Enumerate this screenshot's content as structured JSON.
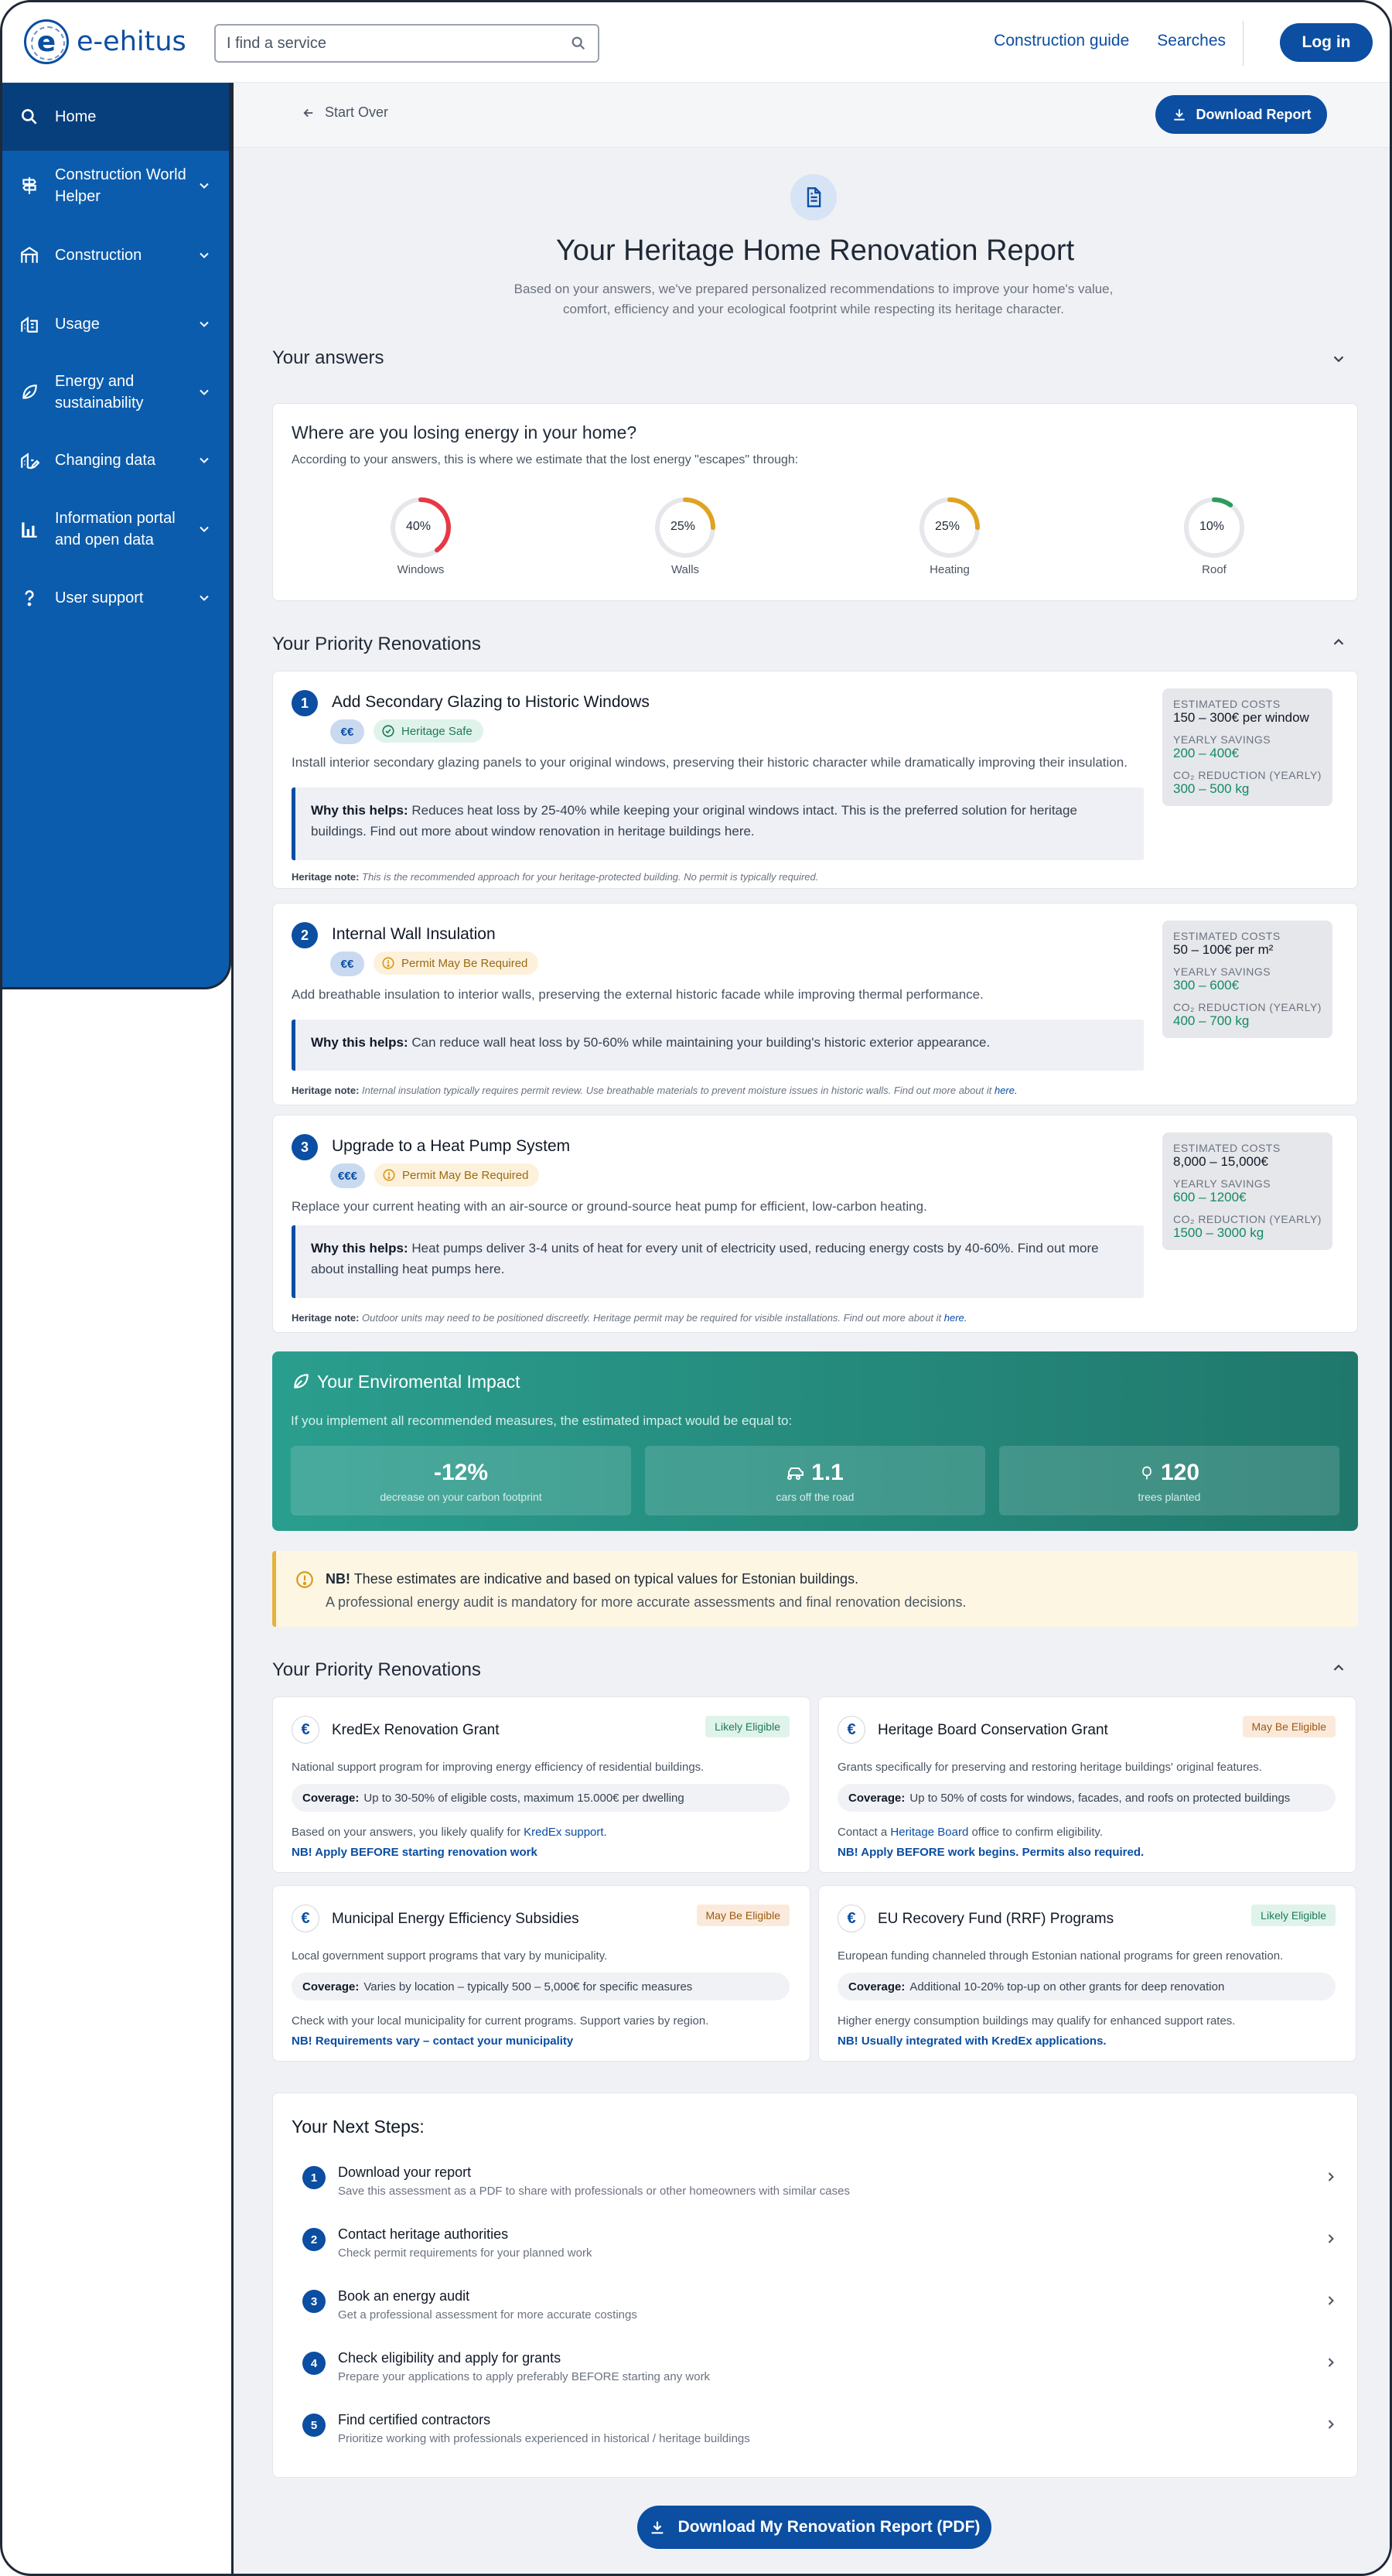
{
  "header": {
    "logo_text": "e-ehitus",
    "search_placeholder": "I find a service",
    "nav": [
      "Construction guide",
      "Searches"
    ],
    "login_label": "Log in"
  },
  "sidebar": {
    "items": [
      {
        "label": "Home",
        "icon": "search-icon",
        "active": true
      },
      {
        "label": "Construction World Helper",
        "icon": "signpost-icon"
      },
      {
        "label": "Construction",
        "icon": "crane-icon"
      },
      {
        "label": "Usage",
        "icon": "building-icon"
      },
      {
        "label": "Energy and sustainability",
        "icon": "leaf-icon"
      },
      {
        "label": "Changing data",
        "icon": "building-edit-icon"
      },
      {
        "label": "Information portal and open data",
        "icon": "bar-chart-icon"
      },
      {
        "label": "User support",
        "icon": "question-icon"
      }
    ]
  },
  "toolbar": {
    "start_over": "Start Over",
    "download_report": "Download Report"
  },
  "page": {
    "title": "Your Heritage Home Renovation Report",
    "subtitle": "Based on your answers, we've prepared personalized recommendations to improve your home's value, comfort, efficiency and your ecological footprint while respecting its heritage character."
  },
  "answers": {
    "section_title": "Your answers",
    "card_title": "Where are you losing energy in your home?",
    "card_sub": "According to your answers, this is where we estimate that the lost energy \"escapes\" through:",
    "donuts": [
      {
        "label": "Windows",
        "percent_text": "40%",
        "value": 0.4,
        "color": "#e63946"
      },
      {
        "label": "Walls",
        "percent_text": "25%",
        "value": 0.25,
        "color": "#e0a320"
      },
      {
        "label": "Heating",
        "percent_text": "25%",
        "value": 0.25,
        "color": "#e0a320"
      },
      {
        "label": "Roof",
        "percent_text": "10%",
        "value": 0.1,
        "color": "#2e9a5e"
      }
    ]
  },
  "priority": {
    "section_title": "Your Priority Renovations",
    "items": [
      {
        "num": "1",
        "title": "Add Secondary Glazing to Historic Windows",
        "cost_badge": "€€",
        "status": "Heritage Safe",
        "status_type": "safe",
        "desc": "Install interior secondary glazing panels to your original windows, preserving their historic character while dramatically improving their insulation.",
        "why_label": "Why this helps:",
        "why_text": "Reduces heat loss by 25-40% while keeping your original windows intact. This is the preferred solution for heritage buildings. Find out more about window renovation in heritage buildings",
        "why_link": "here.",
        "note_label": "Heritage note:",
        "note_text": "This is the recommended approach for your heritage-protected building. No permit is typically required.",
        "note_link": "",
        "cost_label": "ESTIMATED COSTS",
        "cost_value": "150 – 300€ per window",
        "savings_label": "YEARLY SAVINGS",
        "savings_value": "200 – 400€",
        "co2_label": "CO₂ REDUCTION (YEARLY)",
        "co2_value": "300 – 500 kg"
      },
      {
        "num": "2",
        "title": "Internal Wall Insulation",
        "cost_badge": "€€",
        "status": "Permit May Be Required",
        "status_type": "warn",
        "desc": "Add breathable insulation to interior walls, preserving the external historic facade while improving thermal performance.",
        "why_label": "Why this helps:",
        "why_text": "Can reduce wall heat loss by 50-60% while maintaining your building's historic exterior appearance.",
        "why_link": "",
        "note_label": "Heritage note:",
        "note_text": "Internal insulation typically requires permit review. Use breathable materials to prevent moisture issues in historic walls. Find out more about it",
        "note_link": "here.",
        "cost_label": "ESTIMATED COSTS",
        "cost_value": "50 – 100€ per m²",
        "savings_label": "YEARLY SAVINGS",
        "savings_value": "300 – 600€",
        "co2_label": "CO₂ REDUCTION (YEARLY)",
        "co2_value": "400 – 700 kg"
      },
      {
        "num": "3",
        "title": "Upgrade to a Heat Pump System",
        "cost_badge": "€€€",
        "status": "Permit May Be Required",
        "status_type": "warn",
        "desc": "Replace your current heating with an air-source or ground-source heat pump for efficient, low-carbon heating.",
        "why_label": "Why this helps:",
        "why_text": "Heat pumps deliver 3-4 units of heat for every unit of electricity used, reducing energy costs by 40-60%. Find out more about installing heat pumps",
        "why_link": "here.",
        "note_label": "Heritage note:",
        "note_text": "Outdoor units may need to be positioned discreetly. Heritage permit may be required for visible installations. Find out more about it",
        "note_link": "here.",
        "cost_label": "ESTIMATED COSTS",
        "cost_value": "8,000 – 15,000€",
        "savings_label": "YEARLY SAVINGS",
        "savings_value": "600 – 1200€",
        "co2_label": "CO₂ REDUCTION (YEARLY)",
        "co2_value": "1500 – 3000 kg"
      }
    ]
  },
  "impact": {
    "title": "Your Enviromental Impact",
    "sub": "If you implement all recommended measures, the estimated impact would be equal to:",
    "stats": [
      {
        "value": "-12%",
        "label": "decrease on your carbon footprint",
        "icon": ""
      },
      {
        "value": "1.1",
        "label": "cars off the road",
        "icon": "car-icon"
      },
      {
        "value": "120",
        "label": "trees planted",
        "icon": "tree-icon"
      }
    ]
  },
  "notice": {
    "bold": "NB!",
    "line1": "These estimates are indicative and based on typical values for Estonian buildings.",
    "line2": "A professional energy audit is mandatory for more accurate assessments and final renovation decisions."
  },
  "grants": {
    "section_title": "Your Priority Renovations",
    "cov_label": "Coverage:",
    "items": [
      {
        "title": "KredEx Renovation Grant",
        "badge": "Likely Eligible",
        "badge_type": "likely",
        "desc": "National support program for improving energy efficiency of residential buildings.",
        "coverage": "Up to 30-50% of eligible costs, maximum 15.000€ per dwelling",
        "note_pre": "Based on your answers, you likely qualify for",
        "note_link": "KredEx support.",
        "note_post": "",
        "warn_pre": "NB! Apply BEFORE starting renovation work",
        "warn_link": ""
      },
      {
        "title": "Heritage Board Conservation Grant",
        "badge": "May Be Eligible",
        "badge_type": "maybe",
        "desc": "Grants specifically for preserving and restoring heritage buildings' original features.",
        "coverage": "Up to 50% of costs for windows, facades, and roofs on protected buildings",
        "note_pre": "Contact a",
        "note_link": "Heritage Board",
        "note_post": "office to confirm eligibility.",
        "warn_pre": "NB! Apply BEFORE work begins. Permits also required.",
        "warn_link": ""
      },
      {
        "title": "Municipal Energy Efficiency Subsidies",
        "badge": "May Be Eligible",
        "badge_type": "maybe",
        "desc": "Local government support programs that vary by municipality.",
        "coverage": "Varies by location – typically 500 – 5,000€ for specific measures",
        "note_pre": "Check with your local municipality for current programs. Support varies by region.",
        "note_link": "",
        "note_post": "",
        "warn_pre": "NB! Requirements vary – contact your municipality",
        "warn_link": ""
      },
      {
        "title": "EU Recovery Fund (RRF) Programs",
        "badge": "Likely Eligible",
        "badge_type": "likely",
        "desc": "European funding channeled through Estonian national programs for green renovation.",
        "coverage": "Additional 10-20% top-up on other grants for deep renovation",
        "note_pre": "Higher energy consumption buildings may qualify for enhanced support rates.",
        "note_link": "",
        "note_post": "",
        "warn_pre": "NB! Usually integrated with",
        "warn_link": "KredEx applications."
      }
    ]
  },
  "steps": {
    "title": "Your Next Steps:",
    "items": [
      {
        "num": "1",
        "label": "Download your report",
        "desc": "Save this assessment as a PDF to share with professionals or other homeowners with similar cases"
      },
      {
        "num": "2",
        "label": "Contact heritage authorities",
        "desc": "Check permit requirements for your planned work"
      },
      {
        "num": "3",
        "label": "Book an energy audit",
        "desc": "Get a professional assessment for more accurate costings"
      },
      {
        "num": "4",
        "label": "Check eligibility and apply for grants",
        "desc": "Prepare your applications to apply preferably BEFORE starting any work"
      },
      {
        "num": "5",
        "label": "Find certified contractors",
        "desc": "Prioritize working with professionals experienced in historical / heritage buildings"
      }
    ]
  },
  "footer": {
    "download_pdf": "Download My Renovation Report (PDF)"
  },
  "colors": {
    "primary": "#0b4ea2",
    "sidebar": "#0b5cad",
    "impact": "#20786c",
    "green": "#138a63"
  }
}
